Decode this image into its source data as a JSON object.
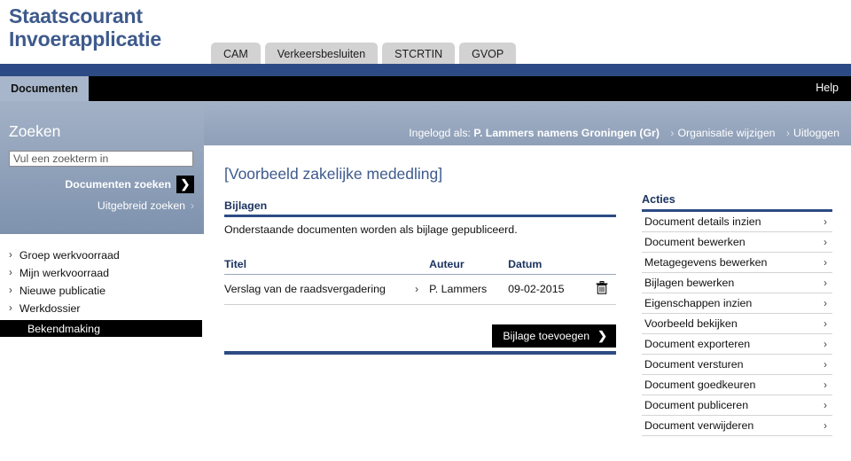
{
  "app": {
    "logo_line1": "Staatscourant",
    "logo_line2": "Invoerapplicatie"
  },
  "top_tabs": [
    {
      "label": "CAM"
    },
    {
      "label": "Verkeersbesluiten"
    },
    {
      "label": "STCRTIN"
    },
    {
      "label": "GVOP"
    }
  ],
  "menubar": {
    "active_tab": "Documenten",
    "help_label": "Help"
  },
  "user_strip": {
    "prefix": "Ingelogd als:",
    "user": "P. Lammers namens Groningen (Gr)",
    "change_org": "Organisatie wijzigen",
    "logout": "Uitloggen",
    "chevron": "›"
  },
  "search": {
    "heading": "Zoeken",
    "placeholder": "Vul een zoekterm in",
    "value": "",
    "submit_label": "Documenten zoeken",
    "advanced_label": "Uitgebreid zoeken",
    "arrow": "❯",
    "chevron": "›"
  },
  "sidebar_nav": [
    {
      "label": "Groep werkvoorraad",
      "active": false
    },
    {
      "label": "Mijn werkvoorraad",
      "active": false
    },
    {
      "label": "Nieuwe publicatie",
      "active": false
    },
    {
      "label": "Werkdossier",
      "active": false
    },
    {
      "label": "Bekendmaking",
      "active": true
    }
  ],
  "main": {
    "page_title": "[Voorbeeld zakelijke mededling]",
    "section_heading": "Bijlagen",
    "section_subtitle": "Onderstaande documenten worden als bijlage gepubliceerd.",
    "table": {
      "columns": [
        "Titel",
        "Auteur",
        "Datum",
        ""
      ],
      "rows": [
        {
          "titel": "Verslag van de raadsvergadering",
          "auteur": "P. Lammers",
          "datum": "09-02-2015",
          "delete_icon": "trash-icon"
        }
      ]
    },
    "add_button": "Bijlage toevoegen",
    "add_button_chevron": "❯"
  },
  "actions": {
    "title": "Acties",
    "chevron": "›",
    "items": [
      {
        "label": "Document details inzien"
      },
      {
        "label": "Document bewerken"
      },
      {
        "label": "Metagegevens bewerken"
      },
      {
        "label": "Bijlagen bewerken"
      },
      {
        "label": "Eigenschappen inzien"
      },
      {
        "label": "Voorbeeld bekijken"
      },
      {
        "label": "Document exporteren"
      },
      {
        "label": "Document versturen"
      },
      {
        "label": "Document goedkeuren"
      },
      {
        "label": "Document publiceren"
      },
      {
        "label": "Document verwijderen"
      }
    ]
  },
  "colors": {
    "brand_blue": "#3e5a8c",
    "dark_blue": "#2c4b84",
    "bar_black": "#000000",
    "panel_blue": "#a3b1c6",
    "tab_gray": "#d2d2d2"
  }
}
